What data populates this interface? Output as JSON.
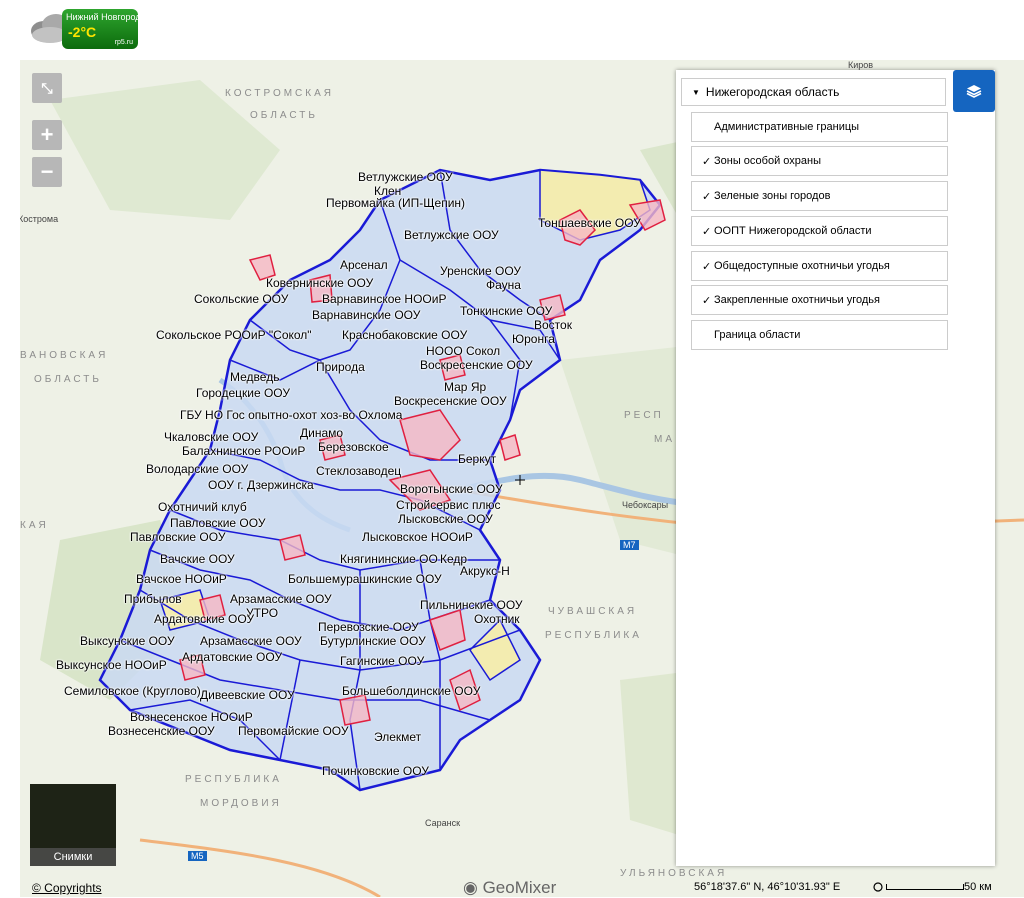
{
  "weather": {
    "city": "Нижний Новгород",
    "temp": "-2°C",
    "source": "rp5.ru"
  },
  "map_controls": {
    "collapse": "⤡",
    "zoom_in": "+",
    "zoom_out": "−"
  },
  "regions": {
    "kostroma": "КОСТРОМСКАЯ",
    "kostroma2": "ОБЛАСТЬ",
    "ivanovo": "ВАНОВСКАЯ",
    "ivanovo2": "ОБЛАСТЬ",
    "chuvash": "ЧУВАШСКАЯ",
    "chuvash2": "РЕСПУБЛИКА",
    "mordovia": "РЕСПУБЛИКА",
    "mordovia2": "МОРДОВИЯ",
    "resp_right": "РЕСП",
    "ma": "МА",
    "kaya": "КАЯ",
    "ulyanovsk": "УЛЬЯНОВСКАЯ"
  },
  "cities": {
    "kostroma": "Кострома",
    "kirov": "Киров",
    "cheboksary": "Чебоксары",
    "saransk": "Саранск",
    "m7": "M7",
    "m5": "M5"
  },
  "labels": [
    "Ветлужские ООУ",
    "Клен",
    "Первомайка (ИП-Щепин)",
    "Ветлужские ООУ",
    "Тоншаевские ООУ",
    "Арсенал",
    "Уренские ООУ",
    "Ковернинские ООУ",
    "Фауна",
    "Сокольские ООУ",
    "Варнавинское НООиР",
    "Тонкинские ООУ",
    "Варнавинские ООУ",
    "Восток",
    "Сокольское РООиР \"Сокол\"",
    "Краснобаковские ООУ",
    "Юронга",
    "НООО Сокол",
    "Природа",
    "Воскресенские ООУ",
    "Медведь",
    "Мар Яр",
    "Городецкие ООУ",
    "Воскресенские ООУ",
    "ГБУ НО Гос опытно-охот хоз-во Охлома",
    "Динамо",
    "Чкаловские ООУ",
    "Березовское",
    "Балахнинское РООиР",
    "Володарские ООУ",
    "Стеклозаводец",
    "Беркут",
    "ООУ г. Дзержинска",
    "Воротынские ООУ",
    "Стройсервис плюс",
    "Охотничий клуб",
    "Лысковские ООУ",
    "Павловские ООУ",
    "Павловские ООУ",
    "Лысковское НООиР",
    "Княгининские ОО",
    "Кедр",
    "Вачские ООУ",
    "Акрукс-Н",
    "Вачское НООиР",
    "Большемурашкинские ООУ",
    "Прибылов",
    "Арзамасские ООУ",
    "Пильнинские ООУ",
    "УТРО",
    "Охотник",
    "Ардатовские ООУ",
    "Перевозские ООУ",
    "Выксунские ООУ",
    "Арзамасские ООУ",
    "Бутурлинские ООУ",
    "Ардатовские ООУ",
    "Гагинские ООУ",
    "Выксунское НООиР",
    "Семиловское (Круглово)",
    "Дивеевские ООУ",
    "Большеболдинские ООУ",
    "Вознесенское НООиР",
    "Вознесенские ООУ",
    "Первомайские ООУ",
    "Элекмет",
    "Починковские ООУ"
  ],
  "panel": {
    "group": "Нижегородская область",
    "layers": [
      {
        "label": "Административные границы",
        "checked": false
      },
      {
        "label": "Зоны особой охраны",
        "checked": true
      },
      {
        "label": "Зеленые зоны городов",
        "checked": true
      },
      {
        "label": "ООПТ Нижегородской области",
        "checked": true
      },
      {
        "label": "Общедоступные охотничьи угодья",
        "checked": true
      },
      {
        "label": "Закрепленные охотничьи угодья",
        "checked": true
      },
      {
        "label": "Граница области",
        "checked": false
      }
    ]
  },
  "thumbnail": {
    "label": "Снимки"
  },
  "footer": {
    "copyright": "© Copyrights",
    "brand": "GeoMixer",
    "coords": "56°18'37.6\" N, 46°10'31.93\" E",
    "scale": "50 км"
  },
  "colors": {
    "accent": "#1565c0",
    "boundary": "#1a1ad6",
    "protected": "#e02040"
  }
}
